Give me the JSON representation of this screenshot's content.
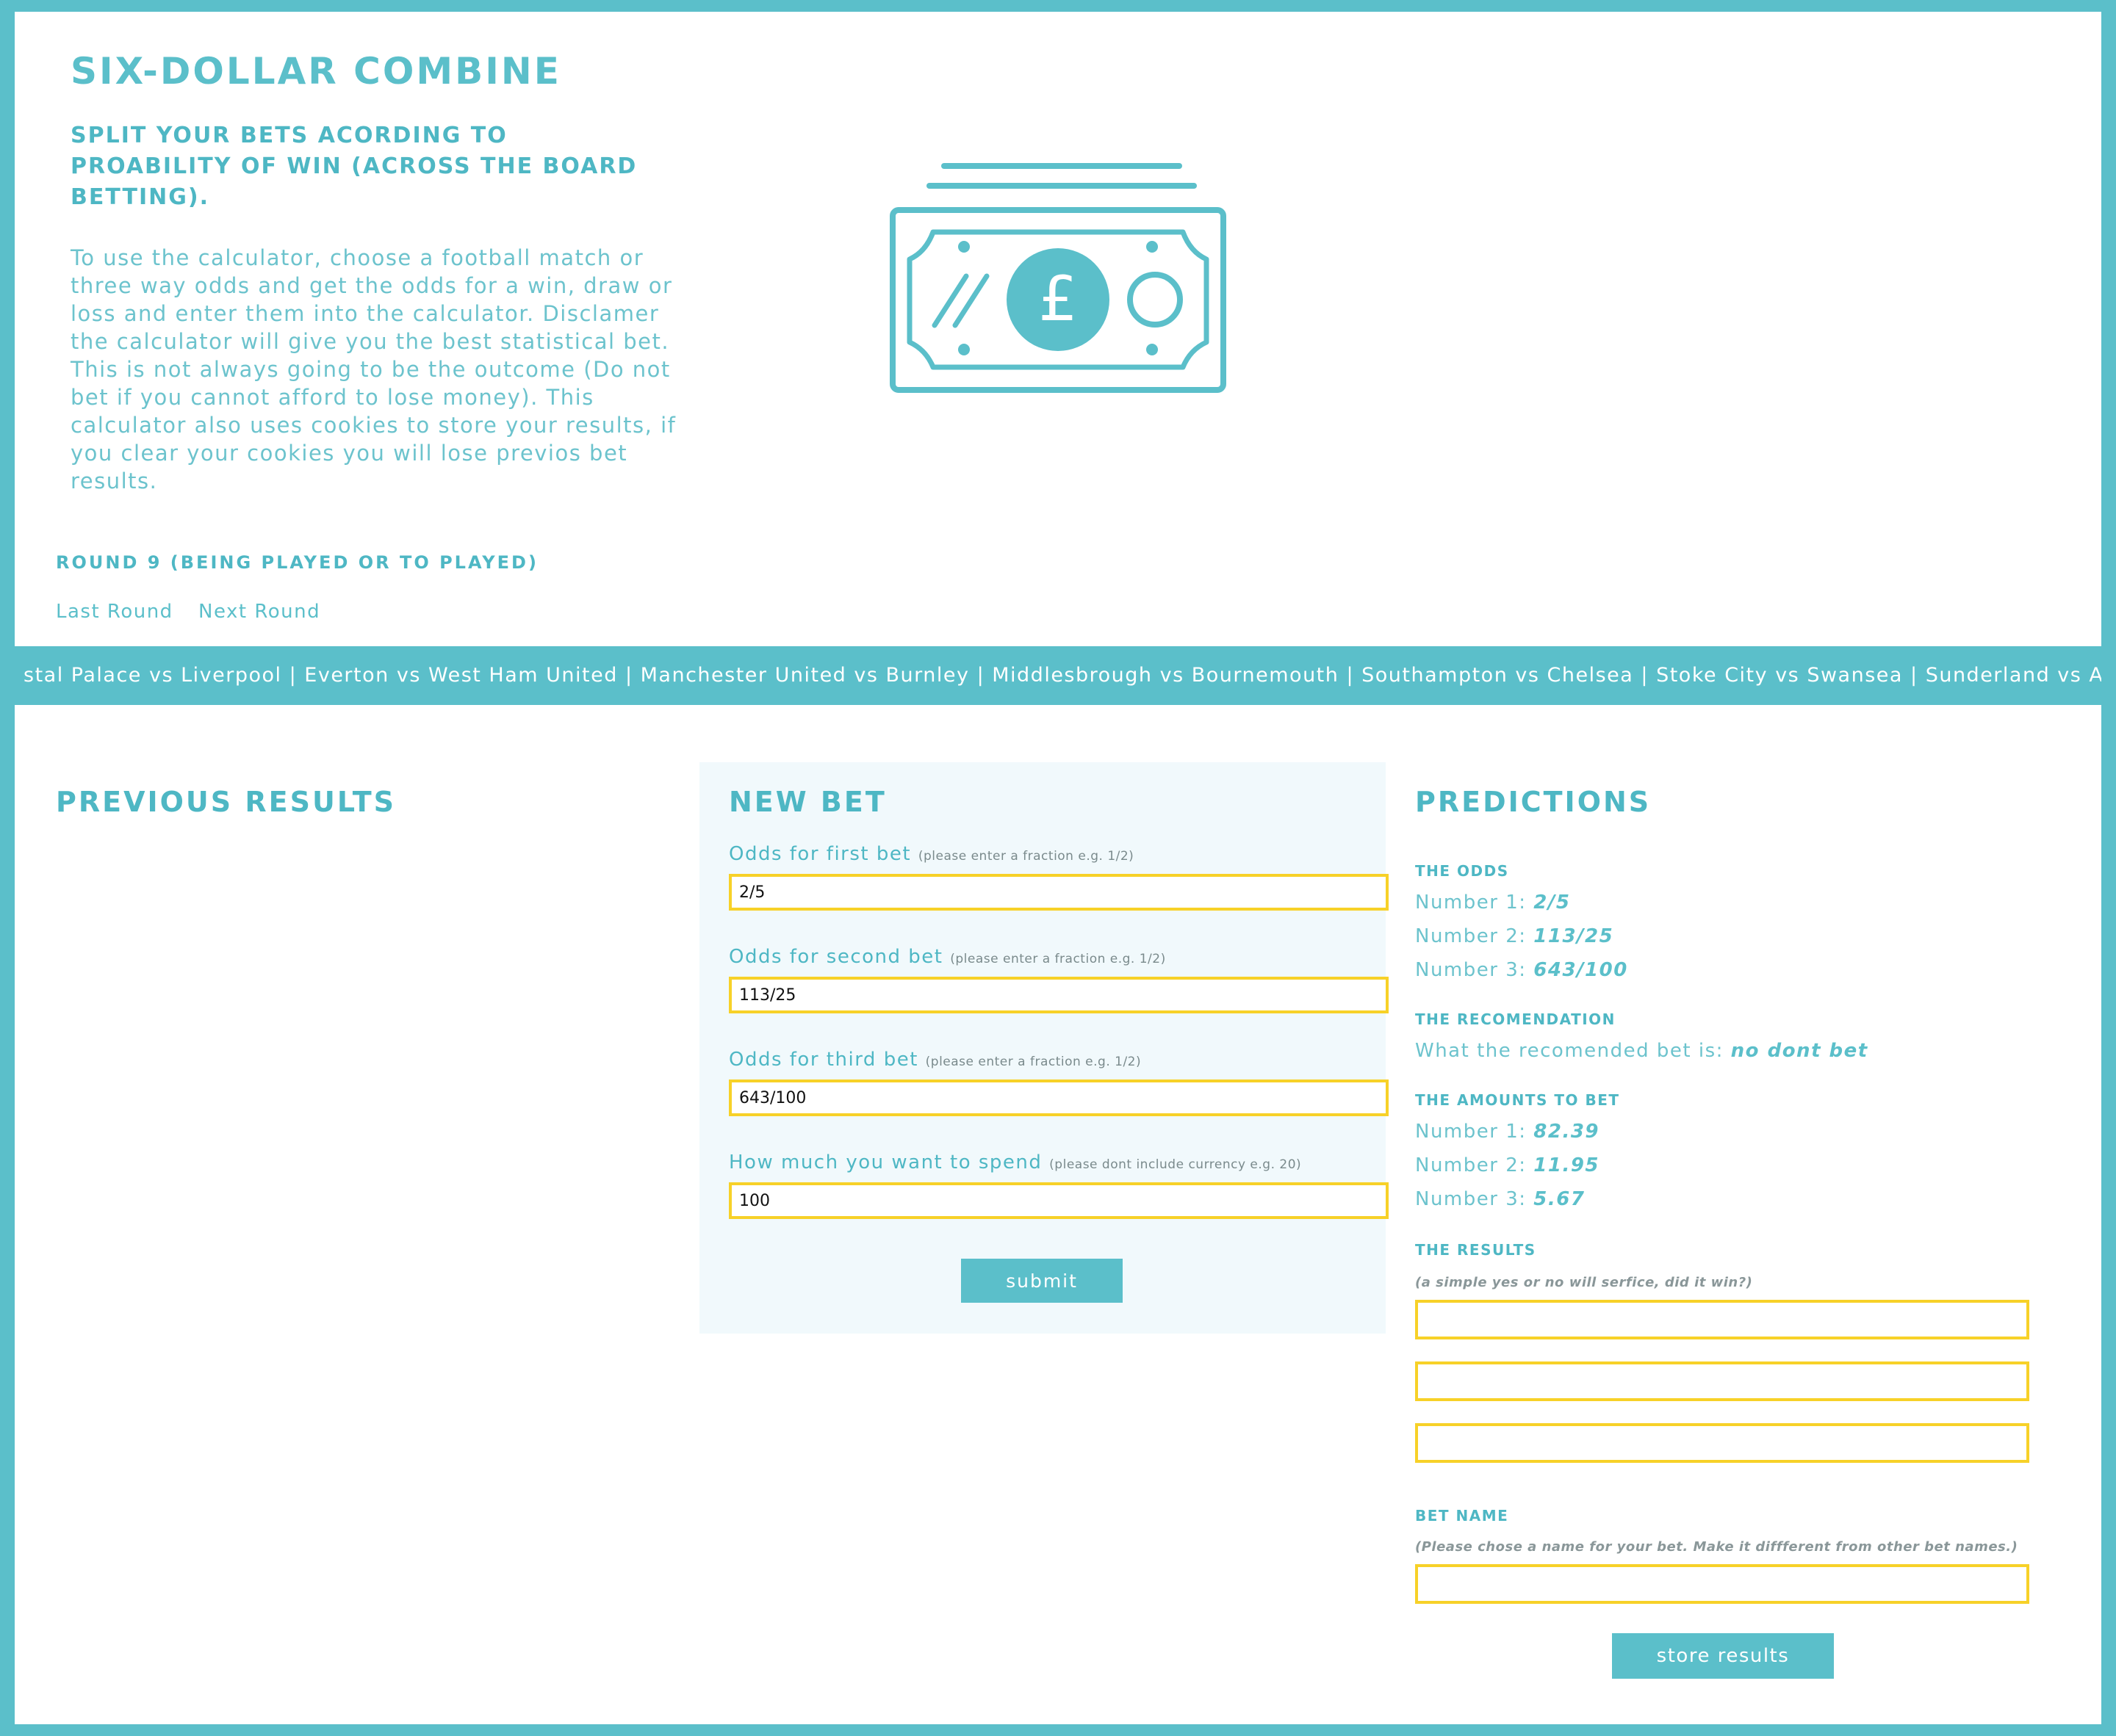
{
  "header": {
    "title": "SIX-DOLLAR COMBINE",
    "subtitle": "SPLIT YOUR BETS ACORDING TO PROABILITY OF WIN (ACROSS THE BOARD BETTING).",
    "intro": "To use the calculator, choose a football match or three way odds and get the odds for a win, draw or loss and enter them into the calculator. Disclamer the calculator will give you the best statistical bet. This is not always going to be the outcome (Do not bet if you cannot afford to lose money). This calculator also uses cookies to store your results, if you clear your cookies you will lose previos bet results.",
    "icon": "pound-banknote-icon"
  },
  "round": {
    "label": "ROUND 9 (BEING PLAYED OR TO PLAYED)",
    "last_label": "Last Round",
    "next_label": "Next Round"
  },
  "ticker": {
    "text": "stal Palace vs Liverpool | Everton vs West Ham United | Manchester United vs Burnley | Middlesbrough vs Bournemouth | Southampton vs Chelsea | Stoke City vs Swansea | Sunderland vs Arsenal | Tottenham Hots"
  },
  "previous": {
    "heading": "PREVIOUS RESULTS"
  },
  "new_bet": {
    "heading": "NEW BET",
    "fields": [
      {
        "label": "Odds for first bet",
        "hint": "(please enter a fraction e.g. 1/2)",
        "value": "2/5"
      },
      {
        "label": "Odds for second bet",
        "hint": "(please enter a fraction e.g. 1/2)",
        "value": "113/25"
      },
      {
        "label": "Odds for third bet",
        "hint": "(please enter a fraction e.g. 1/2)",
        "value": "643/100"
      },
      {
        "label": "How much you want to spend",
        "hint": "(please dont include currency e.g. 20)",
        "value": "100"
      }
    ],
    "submit_label": "submit"
  },
  "predictions": {
    "heading": "PREDICTIONS",
    "odds_heading": "THE ODDS",
    "odds": [
      {
        "label": "Number 1:",
        "value": "2/5"
      },
      {
        "label": "Number 2:",
        "value": "113/25"
      },
      {
        "label": "Number 3:",
        "value": "643/100"
      }
    ],
    "recommendation_heading": "THE RECOMENDATION",
    "recommendation_label": "What the recomended bet is:",
    "recommendation_value": "no dont bet",
    "amounts_heading": "THE AMOUNTS TO BET",
    "amounts": [
      {
        "label": "Number 1:",
        "value": "82.39"
      },
      {
        "label": "Number 2:",
        "value": "11.95"
      },
      {
        "label": "Number 3:",
        "value": "5.67"
      }
    ],
    "results_heading": "THE RESULTS",
    "results_note": "(a simple yes or no will serfice, did it win?)",
    "bet_name_heading": "BET NAME",
    "bet_name_note": "(Please chose a name for your bet. Make it diffferent from other bet names.)",
    "store_label": "store results"
  },
  "colors": {
    "accent": "#5bbfca",
    "input_border": "#f7d128",
    "panel_bg": "#f1f9fc"
  }
}
